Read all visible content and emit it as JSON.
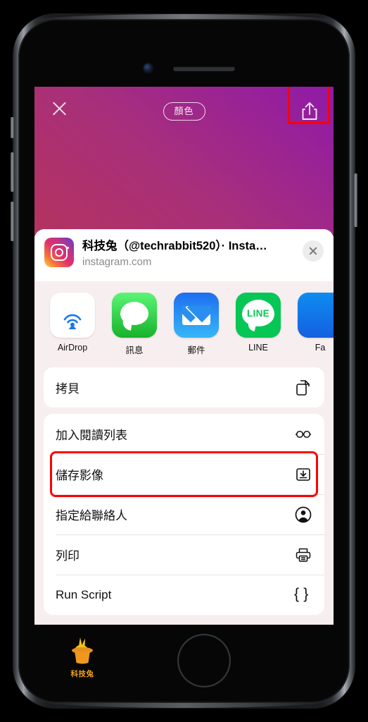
{
  "story": {
    "close_label": "close",
    "color_pill_label": "顏色",
    "share_icon": "share-up-arrow-icon"
  },
  "share_sheet": {
    "header": {
      "app_icon": "instagram-icon",
      "title": "科技兔（@techrabbit520）· Insta…",
      "subtitle": "instagram.com",
      "close_icon": "close-icon"
    },
    "apps": [
      {
        "label": "AirDrop",
        "icon": "airdrop-icon"
      },
      {
        "label": "訊息",
        "icon": "messages-icon"
      },
      {
        "label": "郵件",
        "icon": "mail-icon"
      },
      {
        "label": "LINE",
        "icon": "line-icon",
        "wordmark": "LINE"
      },
      {
        "label": "Fa",
        "icon": "facebook-icon"
      }
    ],
    "action_groups": [
      {
        "items": [
          {
            "label": "拷貝",
            "icon": "copy-icon"
          }
        ]
      },
      {
        "items": [
          {
            "label": "加入閱讀列表",
            "icon": "glasses-icon"
          },
          {
            "label": "儲存影像",
            "icon": "save-image-icon",
            "highlighted": true
          },
          {
            "label": "指定給聯絡人",
            "icon": "contact-icon"
          },
          {
            "label": "列印",
            "icon": "printer-icon"
          },
          {
            "label": "Run Script",
            "icon": "braces-icon"
          }
        ]
      }
    ]
  },
  "watermark": {
    "label": "科技兔",
    "icon": "rabbit-in-hat-icon"
  },
  "colors": {
    "highlight": "#ff0000",
    "sheet_background": "#f7eeef",
    "card": "#ffffff",
    "story_gradient_start": "#b4335f",
    "story_gradient_end": "#8f1aa8",
    "watermark": "#f0a11e"
  }
}
